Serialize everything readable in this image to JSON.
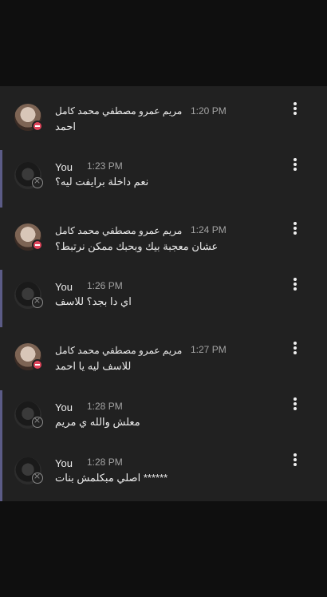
{
  "colors": {
    "panel": "#212121",
    "page": "#0f0f0f",
    "self_accent": "#5b5b86",
    "dnd": "#e0455b"
  },
  "messages": [
    {
      "author": "مريم عمرو مصطفي محمد كامل",
      "time": "1:20 PM",
      "text": "احمد",
      "self": false,
      "status": "dnd",
      "menu_icon": "more-vertical-icon"
    },
    {
      "author": "You",
      "time": "1:23 PM",
      "text": "نعم داخلة برايفت ليه؟",
      "self": true,
      "status": "offline",
      "menu_icon": "more-vertical-icon"
    },
    {
      "author": "مريم عمرو مصطفي محمد كامل",
      "time": "1:24 PM",
      "text": "عشان معجبة بيك وبحبك ممكن نرتبط؟",
      "self": false,
      "status": "dnd",
      "menu_icon": "more-vertical-icon"
    },
    {
      "author": "You",
      "time": "1:26 PM",
      "text": "اي دا بجد؟ للاسف",
      "self": true,
      "status": "offline",
      "menu_icon": "more-vertical-icon"
    },
    {
      "author": "مريم عمرو مصطفي محمد كامل",
      "time": "1:27 PM",
      "text": "للاسف ليه يا احمد",
      "self": false,
      "status": "dnd",
      "menu_icon": "more-vertical-icon"
    },
    {
      "author": "You",
      "time": "1:28 PM",
      "text": "معلش والله ي مريم",
      "self": true,
      "status": "offline",
      "menu_icon": "more-vertical-icon"
    },
    {
      "author": "You",
      "time": "1:28 PM",
      "text": "اصلي مبكلمش بنات ******",
      "self": true,
      "status": "offline",
      "menu_icon": "more-vertical-icon"
    }
  ]
}
